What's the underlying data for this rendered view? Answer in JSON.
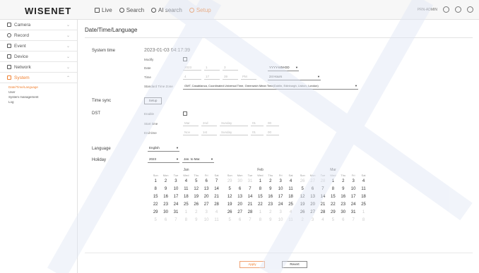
{
  "brand": "WISENET",
  "nav": {
    "live": "Live",
    "search": "Search",
    "ai_search": "AI search",
    "setup": "Setup"
  },
  "topright": {
    "user": "PRN-ADMIN"
  },
  "sidebar": {
    "items": [
      {
        "label": "Camera"
      },
      {
        "label": "Record"
      },
      {
        "label": "Event"
      },
      {
        "label": "Device"
      },
      {
        "label": "Network"
      },
      {
        "label": "System"
      }
    ],
    "sub": [
      "Date/Time/Language",
      "User",
      "System management",
      "Log"
    ]
  },
  "page": {
    "title": "Date/Time/Language"
  },
  "system_time": {
    "label": "System time",
    "current": "2023-01-03 04:17:39",
    "modify": "Modify",
    "date": "Date",
    "date_parts": [
      "2023",
      "1",
      "3"
    ],
    "date_format": "YYYY-MM-DD",
    "time": "Time",
    "time_parts": [
      "4",
      "17",
      "39",
      "PM"
    ],
    "time_format": "24 Hours",
    "tz_label": "Standard Time Zone",
    "tz_value": "GMT, Casablanca, Coordinated Universal Time, Greenwich Mean Time(Dublin, Edinburgh, Lisbon, London)"
  },
  "time_sync": {
    "label": "Time sync",
    "button": "Setup"
  },
  "dst": {
    "label": "DST",
    "enable": "Enable",
    "start": "Start time",
    "end": "End time",
    "start_parts": [
      "Mar",
      "2nd",
      "Sunday",
      "01",
      "00"
    ],
    "end_parts": [
      "Nov",
      "1st",
      "Sunday",
      "01",
      "00"
    ]
  },
  "language": {
    "label": "Language",
    "value": "English"
  },
  "holiday": {
    "label": "Holiday",
    "year": "2023",
    "range": "Jan. to Mar."
  },
  "calendar": {
    "dow": [
      "Sun",
      "Mon",
      "Tue",
      "Wed",
      "Thu",
      "Fri",
      "Sat"
    ],
    "months": [
      {
        "name": "Jan",
        "weeks": [
          [
            "1",
            "2",
            "3",
            "4",
            "5",
            "6",
            "7"
          ],
          [
            "8",
            "9",
            "10",
            "11",
            "12",
            "13",
            "14"
          ],
          [
            "15",
            "16",
            "17",
            "18",
            "19",
            "20",
            "21"
          ],
          [
            "22",
            "23",
            "24",
            "25",
            "26",
            "27",
            "28"
          ],
          [
            "29",
            "30",
            "31",
            "1",
            "2",
            "3",
            "4"
          ],
          [
            "5",
            "6",
            "7",
            "8",
            "9",
            "10",
            "11"
          ]
        ],
        "lead": 0,
        "days": 31
      },
      {
        "name": "Feb",
        "weeks": [
          [
            "29",
            "30",
            "31",
            "1",
            "2",
            "3",
            "4"
          ],
          [
            "5",
            "6",
            "7",
            "8",
            "9",
            "10",
            "11"
          ],
          [
            "12",
            "13",
            "14",
            "15",
            "16",
            "17",
            "18"
          ],
          [
            "19",
            "20",
            "21",
            "22",
            "23",
            "24",
            "25"
          ],
          [
            "26",
            "27",
            "28",
            "1",
            "2",
            "3",
            "4"
          ],
          [
            "5",
            "6",
            "7",
            "8",
            "9",
            "10",
            "11"
          ]
        ],
        "lead": 3,
        "days": 28
      },
      {
        "name": "Mar",
        "weeks": [
          [
            "26",
            "27",
            "28",
            "1",
            "2",
            "3",
            "4"
          ],
          [
            "5",
            "6",
            "7",
            "8",
            "9",
            "10",
            "11"
          ],
          [
            "12",
            "13",
            "14",
            "15",
            "16",
            "17",
            "18"
          ],
          [
            "19",
            "20",
            "21",
            "22",
            "23",
            "24",
            "25"
          ],
          [
            "26",
            "27",
            "28",
            "29",
            "30",
            "31",
            "1"
          ],
          [
            "2",
            "3",
            "4",
            "5",
            "6",
            "7",
            "8"
          ]
        ],
        "lead": 3,
        "days": 31
      }
    ]
  },
  "buttons": {
    "apply": "Apply",
    "revert": "Revert"
  },
  "colors": {
    "accent": "#f08030"
  }
}
